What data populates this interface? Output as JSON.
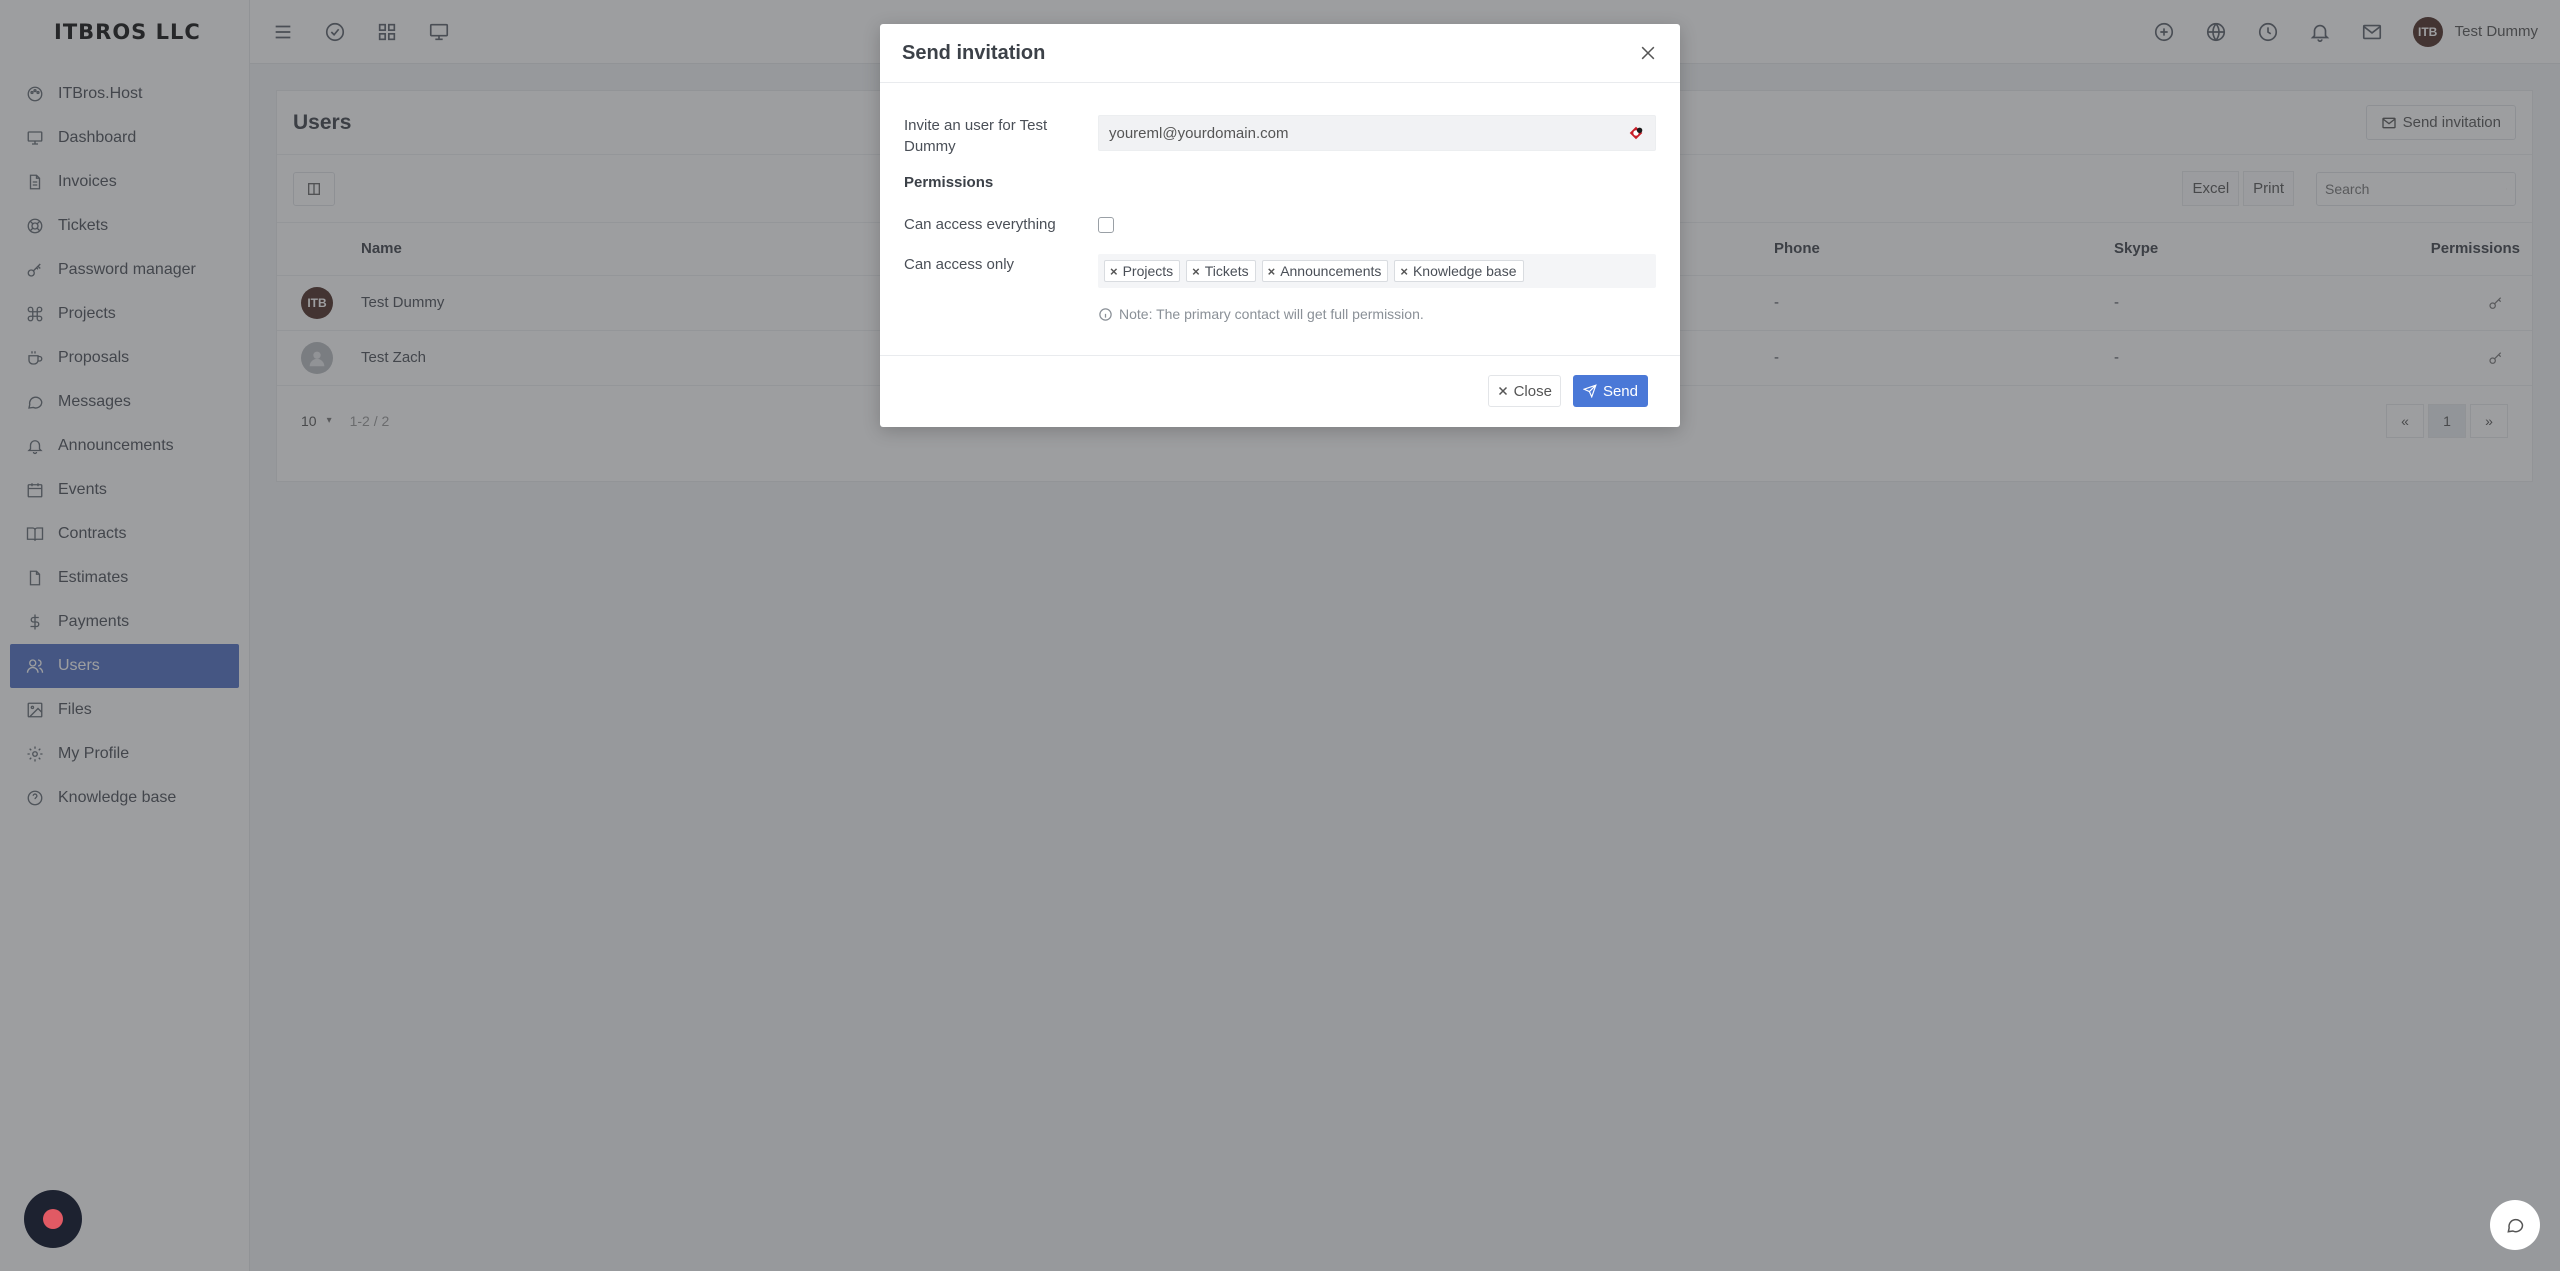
{
  "brand": "ITBROS LLC",
  "sidebar": {
    "items": [
      {
        "label": "ITBros.Host",
        "icon": "palette-icon"
      },
      {
        "label": "Dashboard",
        "icon": "monitor-icon"
      },
      {
        "label": "Invoices",
        "icon": "file-text-icon"
      },
      {
        "label": "Tickets",
        "icon": "life-buoy-icon"
      },
      {
        "label": "Password manager",
        "icon": "key-icon"
      },
      {
        "label": "Projects",
        "icon": "command-icon"
      },
      {
        "label": "Proposals",
        "icon": "coffee-icon"
      },
      {
        "label": "Messages",
        "icon": "message-circle-icon"
      },
      {
        "label": "Announcements",
        "icon": "bell-icon"
      },
      {
        "label": "Events",
        "icon": "calendar-icon"
      },
      {
        "label": "Contracts",
        "icon": "book-icon"
      },
      {
        "label": "Estimates",
        "icon": "file-icon"
      },
      {
        "label": "Payments",
        "icon": "dollar-icon"
      },
      {
        "label": "Users",
        "icon": "users-icon",
        "active": true
      },
      {
        "label": "Files",
        "icon": "image-icon"
      },
      {
        "label": "My Profile",
        "icon": "settings-icon"
      },
      {
        "label": "Knowledge base",
        "icon": "help-circle-icon"
      }
    ]
  },
  "topbar": {
    "avatar_initials": "ITB",
    "user_name": "Test Dummy"
  },
  "page": {
    "title": "Users",
    "send_invitation": "Send invitation",
    "excel": "Excel",
    "print": "Print",
    "search_placeholder": "Search",
    "columns": {
      "name": "Name",
      "phone": "Phone",
      "skype": "Skype",
      "permissions": "Permissions"
    },
    "rows": [
      {
        "name": "Test Dummy",
        "phone": "-",
        "skype": "-",
        "avatar": "ITB"
      },
      {
        "name": "Test Zach",
        "phone": "-",
        "skype": "-",
        "avatar": ""
      }
    ],
    "page_size": "10",
    "page_info": "1-2 / 2",
    "current_page": "1"
  },
  "modal": {
    "title": "Send invitation",
    "invite_label": "Invite an user for Test Dummy",
    "email_value": "youreml@yourdomain.com",
    "permissions_heading": "Permissions",
    "access_everything_label": "Can access everything",
    "access_only_label": "Can access only",
    "tags": [
      "Projects",
      "Tickets",
      "Announcements",
      "Knowledge base"
    ],
    "note": "Note: The primary contact will get full permission.",
    "close_label": "Close",
    "send_label": "Send"
  },
  "colors": {
    "accent": "#4e6fc4",
    "send_button": "#4a78d7",
    "overlay": "rgba(60,62,66,0.5)"
  }
}
